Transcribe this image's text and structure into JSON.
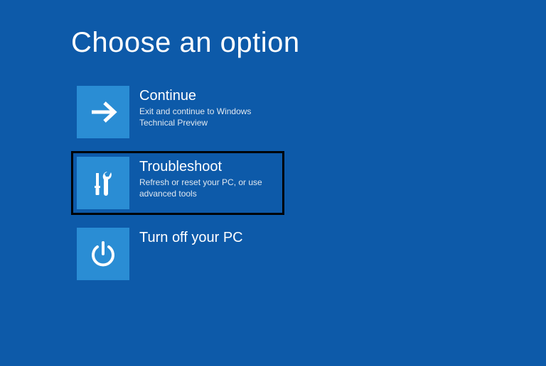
{
  "title": "Choose an option",
  "options": [
    {
      "label": "Continue",
      "description": "Exit and continue to Windows Technical Preview"
    },
    {
      "label": "Troubleshoot",
      "description": "Refresh or reset your PC, or use advanced tools"
    },
    {
      "label": "Turn off your PC",
      "description": ""
    }
  ]
}
